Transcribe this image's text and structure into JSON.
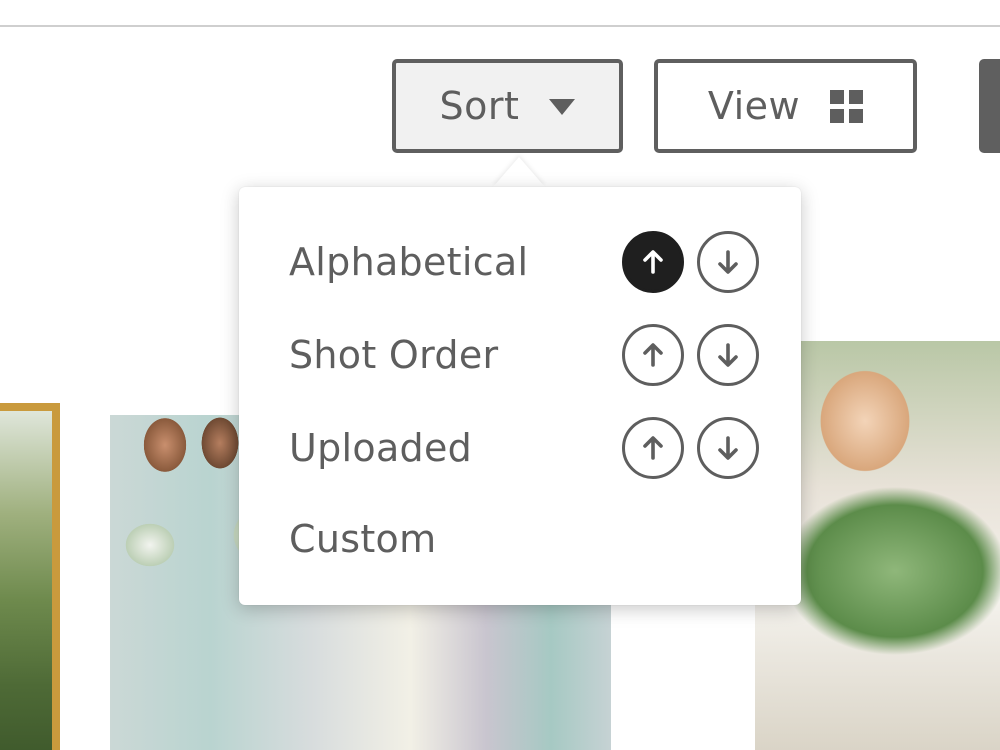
{
  "toolbar": {
    "sort_label": "Sort",
    "view_label": "View"
  },
  "sort_menu": {
    "options": [
      {
        "label": "Alphabetical",
        "ascending_active": true
      },
      {
        "label": "Shot Order",
        "ascending_active": false
      },
      {
        "label": "Uploaded",
        "ascending_active": false
      },
      {
        "label": "Custom"
      }
    ]
  },
  "colors": {
    "button_border": "#5f5f5f",
    "active_direction": "#1f1f1f",
    "selected_photo_border": "#c99a3d"
  },
  "icons": {
    "sort_caret": "caret-down-icon",
    "view": "grid-icon",
    "ascending": "arrow-up-circle-icon",
    "descending": "arrow-down-circle-icon"
  }
}
